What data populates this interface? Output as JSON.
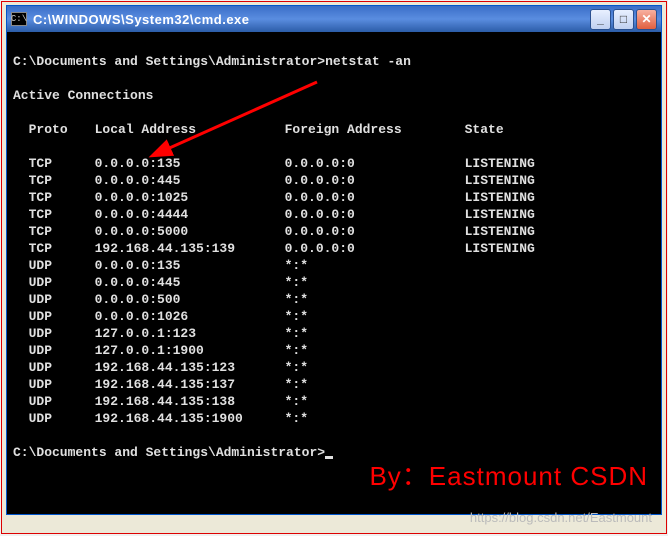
{
  "window": {
    "title": "C:\\WINDOWS\\System32\\cmd.exe",
    "icon_label": "C:\\"
  },
  "prompt1": {
    "path": "C:\\Documents and Settings\\Administrator>",
    "command": "netstat -an"
  },
  "active_line": "Active Connections",
  "headers": {
    "proto": "Proto",
    "local": "Local Address",
    "foreign": "Foreign Address",
    "state": "State"
  },
  "connections": [
    {
      "proto": "TCP",
      "local": "0.0.0.0:135",
      "foreign": "0.0.0.0:0",
      "state": "LISTENING"
    },
    {
      "proto": "TCP",
      "local": "0.0.0.0:445",
      "foreign": "0.0.0.0:0",
      "state": "LISTENING"
    },
    {
      "proto": "TCP",
      "local": "0.0.0.0:1025",
      "foreign": "0.0.0.0:0",
      "state": "LISTENING"
    },
    {
      "proto": "TCP",
      "local": "0.0.0.0:4444",
      "foreign": "0.0.0.0:0",
      "state": "LISTENING"
    },
    {
      "proto": "TCP",
      "local": "0.0.0.0:5000",
      "foreign": "0.0.0.0:0",
      "state": "LISTENING"
    },
    {
      "proto": "TCP",
      "local": "192.168.44.135:139",
      "foreign": "0.0.0.0:0",
      "state": "LISTENING"
    },
    {
      "proto": "UDP",
      "local": "0.0.0.0:135",
      "foreign": "*:*",
      "state": ""
    },
    {
      "proto": "UDP",
      "local": "0.0.0.0:445",
      "foreign": "*:*",
      "state": ""
    },
    {
      "proto": "UDP",
      "local": "0.0.0.0:500",
      "foreign": "*:*",
      "state": ""
    },
    {
      "proto": "UDP",
      "local": "0.0.0.0:1026",
      "foreign": "*:*",
      "state": ""
    },
    {
      "proto": "UDP",
      "local": "127.0.0.1:123",
      "foreign": "*:*",
      "state": ""
    },
    {
      "proto": "UDP",
      "local": "127.0.0.1:1900",
      "foreign": "*:*",
      "state": ""
    },
    {
      "proto": "UDP",
      "local": "192.168.44.135:123",
      "foreign": "*:*",
      "state": ""
    },
    {
      "proto": "UDP",
      "local": "192.168.44.135:137",
      "foreign": "*:*",
      "state": ""
    },
    {
      "proto": "UDP",
      "local": "192.168.44.135:138",
      "foreign": "*:*",
      "state": ""
    },
    {
      "proto": "UDP",
      "local": "192.168.44.135:1900",
      "foreign": "*:*",
      "state": ""
    }
  ],
  "prompt2": {
    "path": "C:\\Documents and Settings\\Administrator>"
  },
  "watermark": "By：Eastmount CSDN",
  "url": "https://blog.csdn.net/Eastmount"
}
